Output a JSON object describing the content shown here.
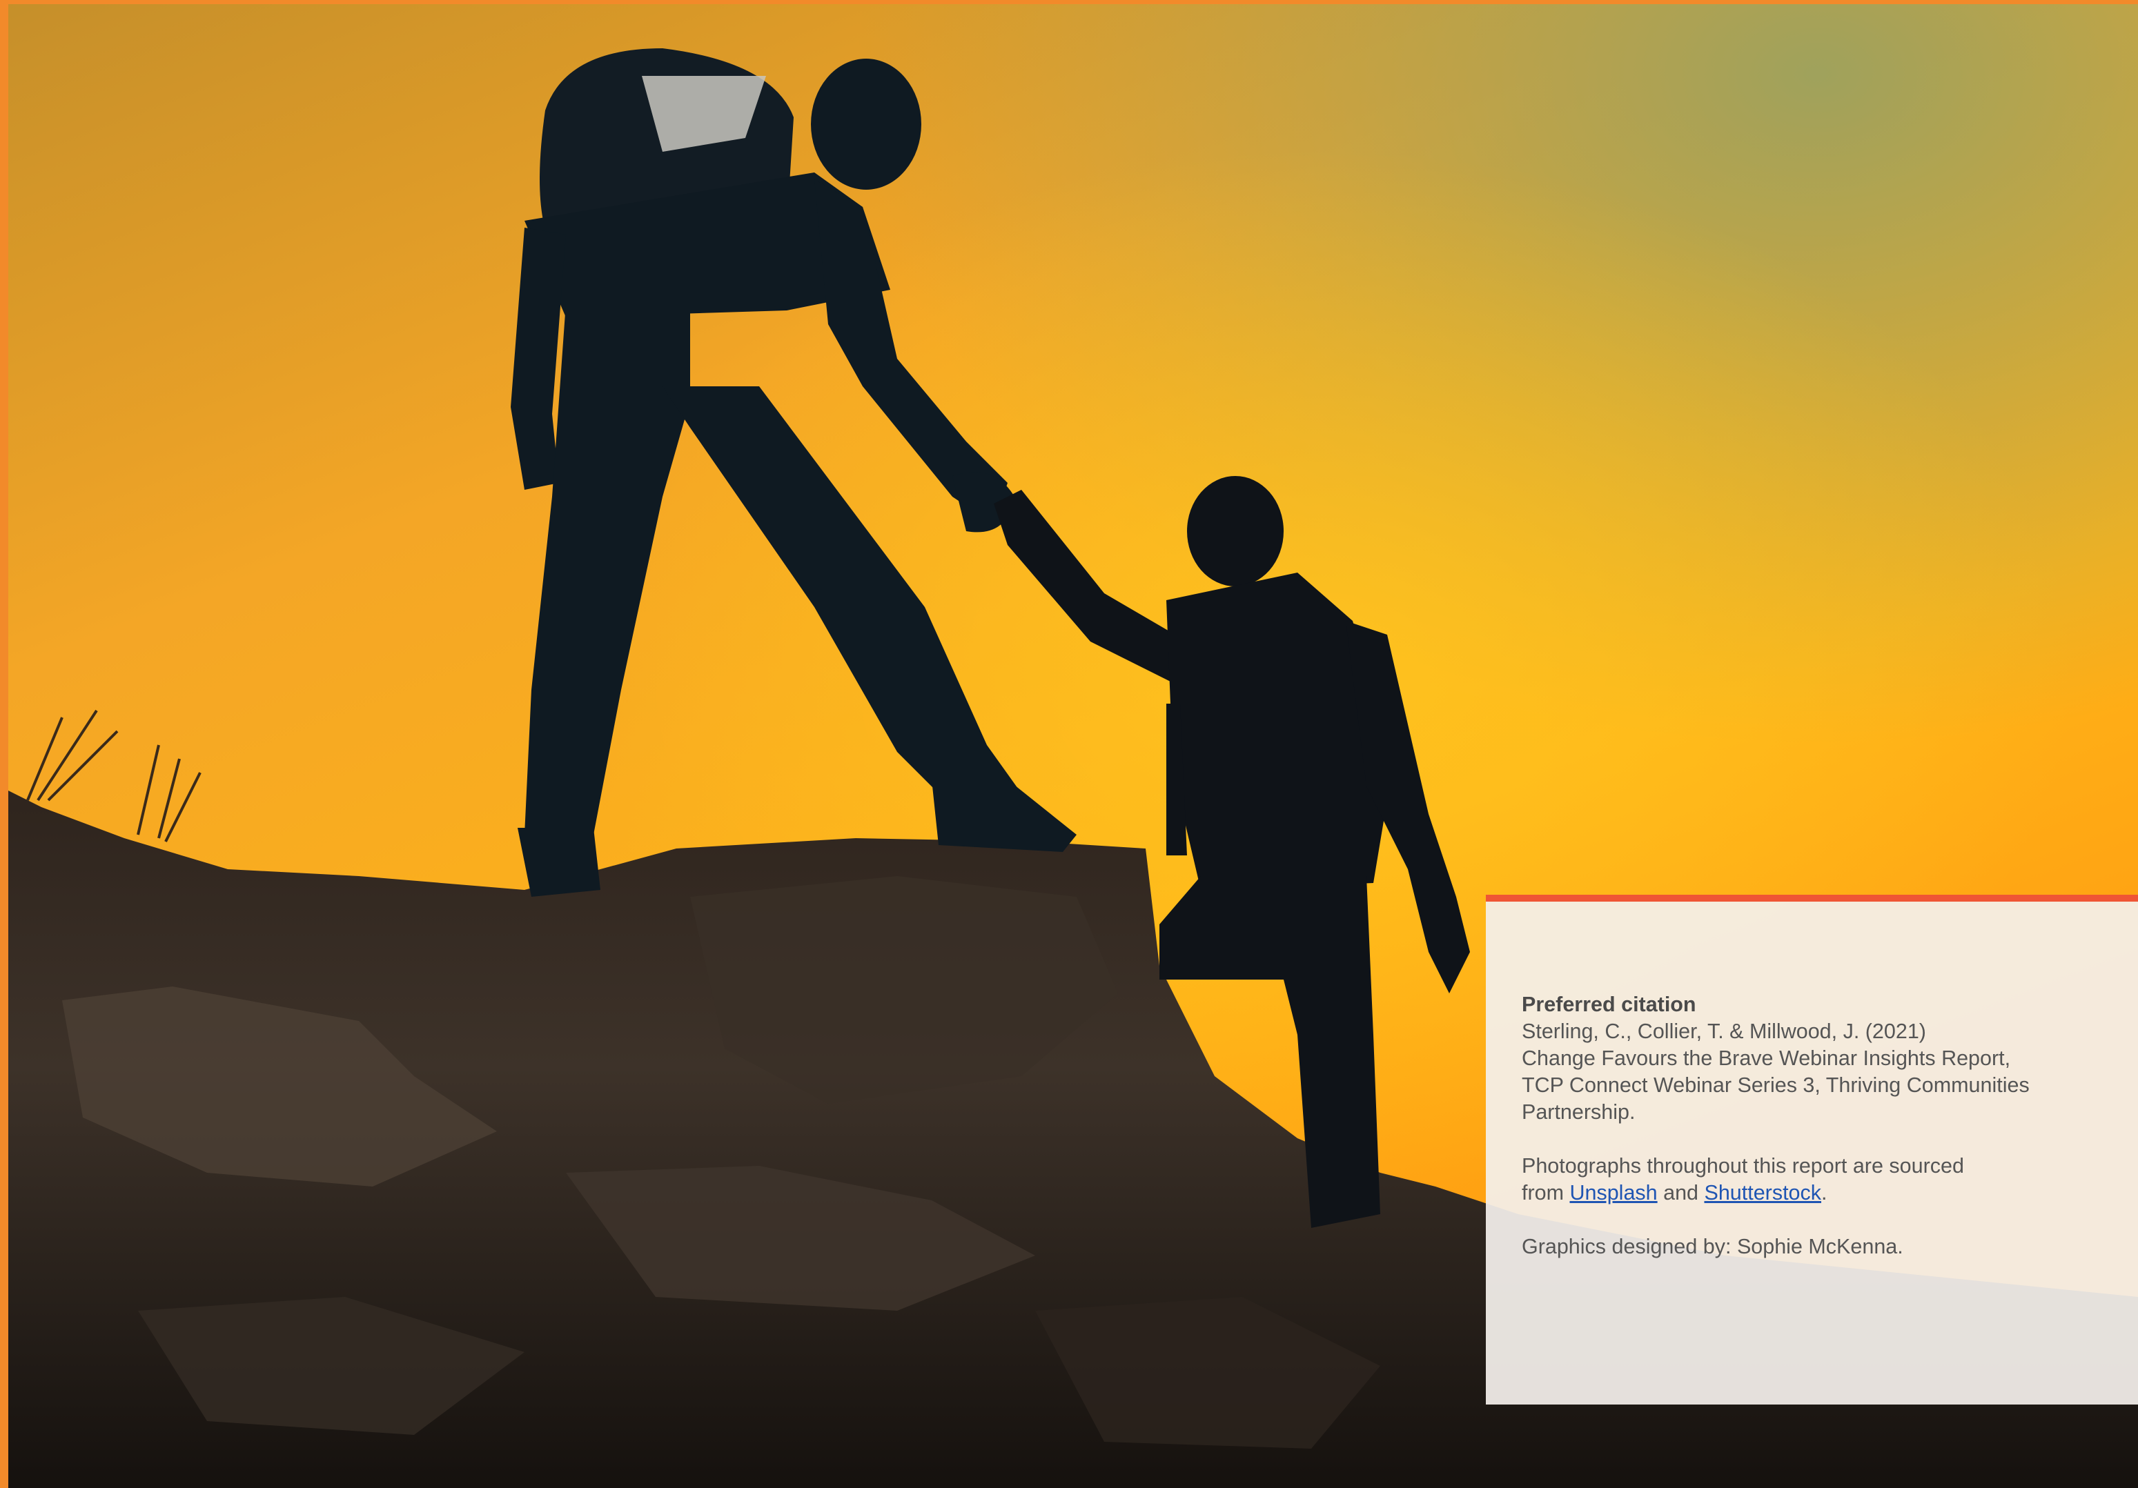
{
  "citation": {
    "heading": "Preferred citation",
    "authors_line": "Sterling, C., Collier, T. & Millwood, J. (2021)",
    "title_line_1": "Change Favours the Brave Webinar Insights Report,",
    "title_line_2": "TCP Connect Webinar Series 3, Thriving Communities",
    "title_line_3": "Partnership."
  },
  "photos": {
    "line1": "Photographs throughout this report are sourced",
    "from_text": "from ",
    "link1": "Unsplash",
    "and_text": " and ",
    "link2": "Shutterstock",
    "period": "."
  },
  "graphics_credit": "Graphics designed by: Sophie McKenna.",
  "colors": {
    "frame_orange": "#f28a2a",
    "panel_top_bar": "#ef5535",
    "link_blue": "#1f55b3",
    "text_gray": "#555555"
  }
}
